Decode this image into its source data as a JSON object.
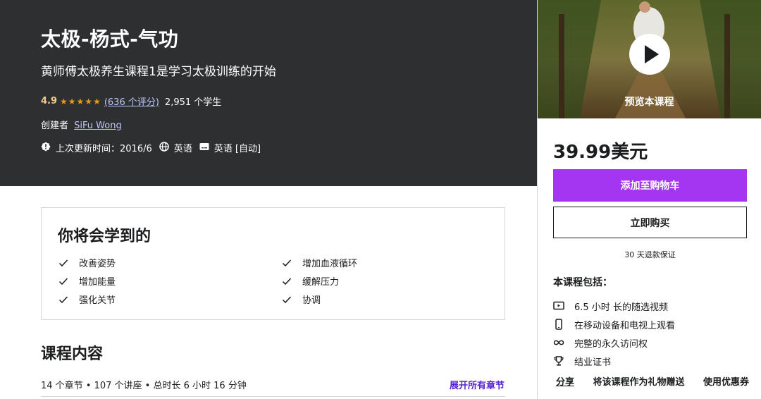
{
  "course": {
    "title": "太极-杨式-气功",
    "subtitle": "黄师傅太极养生课程1是学习太极训练的开始",
    "rating": "4.9",
    "stars": "★★★★★",
    "ratings_count": "(636 个评分)",
    "students": "2,951 个学生",
    "creator_label": "创建者",
    "creator_name": "SiFu Wong",
    "last_updated": "上次更新时间：2016/6",
    "language": "英语",
    "captions": "英语 [自动]"
  },
  "sidebar": {
    "preview_label": "预览本课程",
    "price": "39.99美元",
    "add_to_cart": "添加至购物车",
    "buy_now": "立即购买",
    "guarantee": "30 天退款保证",
    "includes_title": "本课程包括：",
    "includes": [
      {
        "icon": "video-icon",
        "text": "6.5 小时 长的随选视频"
      },
      {
        "icon": "mobile-icon",
        "text": "在移动设备和电视上观看"
      },
      {
        "icon": "infinity-icon",
        "text": "完整的永久访问权"
      },
      {
        "icon": "trophy-icon",
        "text": "结业证书"
      }
    ],
    "share": "分享",
    "gift": "将该课程作为礼物赠送",
    "coupon": "使用优惠券"
  },
  "learn": {
    "title": "你将会学到的",
    "items": [
      "改善姿势",
      "增加血液循环",
      "增加能量",
      "缓解压力",
      "强化关节",
      "协调"
    ]
  },
  "content": {
    "title": "课程内容",
    "meta": "14 个章节 • 107 个讲座 • 总时长 6 小时 16 分钟",
    "expand_all": "展开所有章节"
  }
}
